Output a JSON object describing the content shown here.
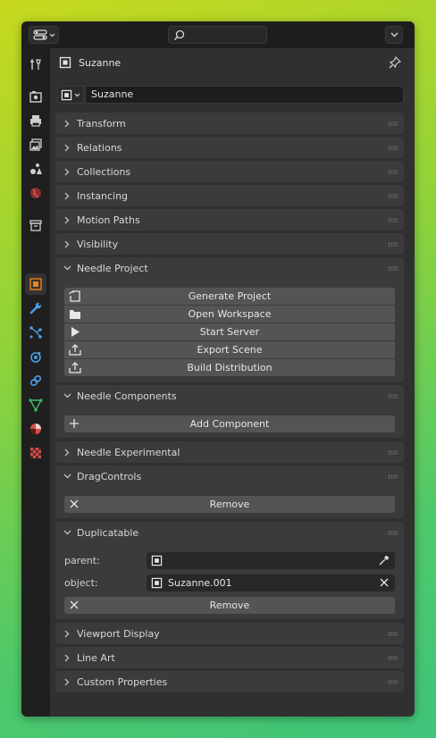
{
  "header": {
    "object_name": "Suzanne"
  },
  "datablock": {
    "name": "Suzanne"
  },
  "search": {
    "placeholder": ""
  },
  "sidebar": {
    "tabs": [
      {
        "name": "tool-tab",
        "icon": "tool-icon",
        "active": false
      },
      {
        "name": "render-tab",
        "icon": "render-icon",
        "active": false
      },
      {
        "name": "output-tab",
        "icon": "printer-icon",
        "active": false
      },
      {
        "name": "view-layer-tab",
        "icon": "view-layer-icon",
        "active": false
      },
      {
        "name": "scene-tab",
        "icon": "scene-icon",
        "active": false
      },
      {
        "name": "world-tab",
        "icon": "world-icon",
        "active": false
      },
      {
        "name": "collection-tab",
        "icon": "collection-icon",
        "active": false
      },
      {
        "name": "object-tab",
        "icon": "object-icon",
        "active": true
      },
      {
        "name": "modifier-tab",
        "icon": "wrench-icon",
        "active": false
      },
      {
        "name": "particles-tab",
        "icon": "particles-icon",
        "active": false
      },
      {
        "name": "physics-tab",
        "icon": "physics-icon",
        "active": false
      },
      {
        "name": "constraints-tab",
        "icon": "constraint-icon",
        "active": false
      },
      {
        "name": "data-tab",
        "icon": "mesh-data-icon",
        "active": false
      },
      {
        "name": "material-tab",
        "icon": "material-icon",
        "active": false
      },
      {
        "name": "texture-tab",
        "icon": "texture-icon",
        "active": false
      }
    ]
  },
  "panels": {
    "transform": "Transform",
    "relations": "Relations",
    "collections": "Collections",
    "instancing": "Instancing",
    "motion_paths": "Motion Paths",
    "visibility": "Visibility",
    "needle_project": {
      "title": "Needle Project",
      "buttons": [
        "Generate Project",
        "Open Workspace",
        "Start Server",
        "Export Scene",
        "Build Distribution"
      ]
    },
    "needle_components": {
      "title": "Needle Components",
      "add_label": "Add Component"
    },
    "needle_experimental": "Needle Experimental",
    "drag_controls": {
      "title": "DragControls",
      "remove_label": "Remove"
    },
    "duplicatable": {
      "title": "Duplicatable",
      "parent_label": "parent:",
      "parent_value": "",
      "object_label": "object:",
      "object_value": "Suzanne.001",
      "remove_label": "Remove"
    },
    "viewport_display": "Viewport Display",
    "line_art": "Line Art",
    "custom_properties": "Custom Properties"
  },
  "colors": {
    "accent_orange": "#e8841c",
    "blue_icon": "#4a9fe8",
    "green_icon": "#3fbf6a",
    "red_icon": "#d0504a"
  }
}
